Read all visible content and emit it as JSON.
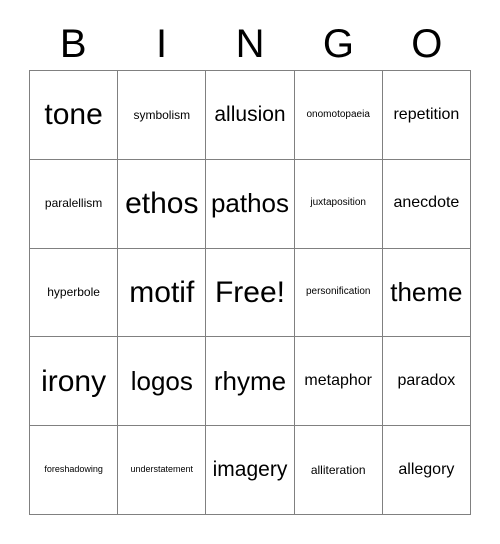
{
  "card": {
    "title": "BINGO",
    "header_letters": [
      "B",
      "I",
      "N",
      "G",
      "O"
    ],
    "free_space_label": "Free!",
    "grid_size": "5x5",
    "border_color": "#808080",
    "text_color": "#000000",
    "background_color": "#ffffff",
    "rows": [
      [
        {
          "label": "tone",
          "size": "fs-xxl"
        },
        {
          "label": "symbolism",
          "size": "fs-sm"
        },
        {
          "label": "allusion",
          "size": "fs-lg"
        },
        {
          "label": "onomotopaeia",
          "size": "fs-xs"
        },
        {
          "label": "repetition",
          "size": "fs-md"
        }
      ],
      [
        {
          "label": "paralellism",
          "size": "fs-sm"
        },
        {
          "label": "ethos",
          "size": "fs-xxl"
        },
        {
          "label": "pathos",
          "size": "fs-xl"
        },
        {
          "label": "juxtaposition",
          "size": "fs-xs"
        },
        {
          "label": "anecdote",
          "size": "fs-md"
        }
      ],
      [
        {
          "label": "hyperbole",
          "size": "fs-sm"
        },
        {
          "label": "motif",
          "size": "fs-xxl"
        },
        {
          "label": "Free!",
          "size": "fs-xxl"
        },
        {
          "label": "personification",
          "size": "fs-xs"
        },
        {
          "label": "theme",
          "size": "fs-xl"
        }
      ],
      [
        {
          "label": "irony",
          "size": "fs-xxl"
        },
        {
          "label": "logos",
          "size": "fs-xl"
        },
        {
          "label": "rhyme",
          "size": "fs-xl"
        },
        {
          "label": "metaphor",
          "size": "fs-md"
        },
        {
          "label": "paradox",
          "size": "fs-md"
        }
      ],
      [
        {
          "label": "foreshadowing",
          "size": "fs-xxs"
        },
        {
          "label": "understatement",
          "size": "fs-xxs"
        },
        {
          "label": "imagery",
          "size": "fs-lg"
        },
        {
          "label": "alliteration",
          "size": "fs-sm"
        },
        {
          "label": "allegory",
          "size": "fs-md"
        }
      ]
    ]
  }
}
